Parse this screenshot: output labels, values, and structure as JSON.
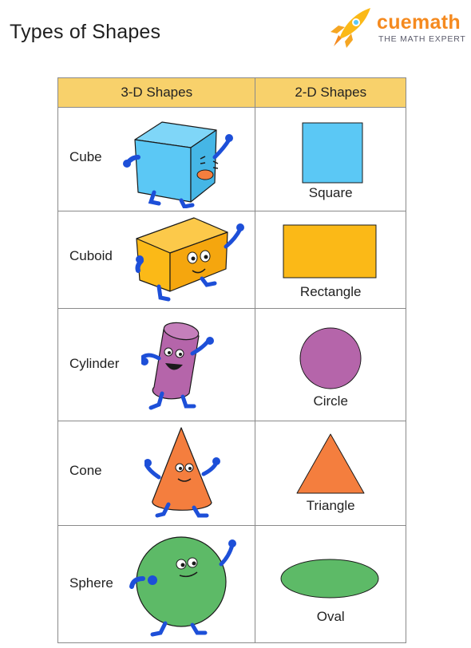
{
  "title": "Types of Shapes",
  "brand": {
    "name": "cuemath",
    "tagline": "THE MATH EXPERT"
  },
  "table": {
    "headers": [
      "3-D Shapes",
      "2-D Shapes"
    ],
    "rows": [
      {
        "shape3d": "Cube",
        "shape2d": "Square"
      },
      {
        "shape3d": "Cuboid",
        "shape2d": "Rectangle"
      },
      {
        "shape3d": "Cylinder",
        "shape2d": "Circle"
      },
      {
        "shape3d": "Cone",
        "shape2d": "Triangle"
      },
      {
        "shape3d": "Sphere",
        "shape2d": "Oval"
      }
    ]
  },
  "colors": {
    "header_bg": "#f8d16b",
    "cube_square": "#5bc8f5",
    "cuboid_rectangle": "#fbb917",
    "cylinder_circle": "#b565aa",
    "cone_triangle": "#f47e3e",
    "sphere_oval": "#5dba67",
    "limbs": "#1d4fd8",
    "brand_orange": "#f58a1f"
  }
}
